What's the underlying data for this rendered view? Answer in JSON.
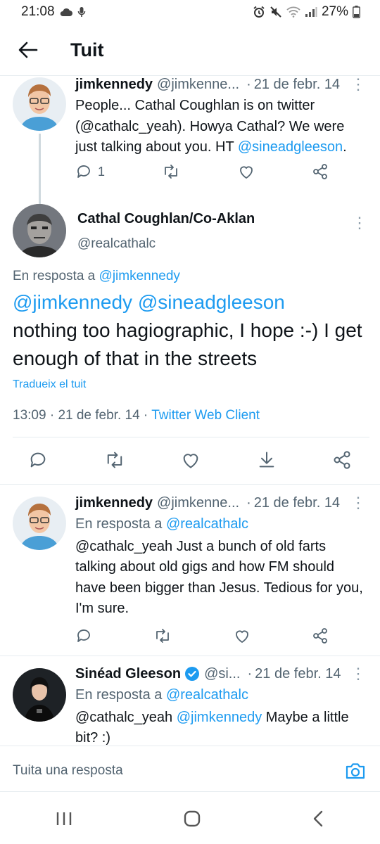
{
  "status_bar": {
    "time": "21:08",
    "battery": "27%"
  },
  "header": {
    "title": "Tuit"
  },
  "tweet1": {
    "name": "jimkennedy",
    "handle": "@jimkenne...",
    "date": "21 de febr. 14",
    "text_main": "People... Cathal Coughlan is on twitter (@cathalc_yeah). Howya Cathal? We were just talking about you. HT ",
    "text_link": "@sineadgleeson",
    "text_end": ".",
    "reply_count": "1"
  },
  "main_tweet": {
    "name": "Cathal Coughlan/Co-Aklan",
    "handle": "@realcathalc",
    "reply_prefix": "En resposta a ",
    "reply_to": "@jimkennedy",
    "mention1": "@jimkennedy",
    "mention2": "@sineadgleeson",
    "body": "nothing too hagiographic, I hope :-) I get enough of that in the streets",
    "translate": "Tradueix el tuit",
    "time": "13:09",
    "date": "21 de febr. 14",
    "client": "Twitter Web Client"
  },
  "tweet3": {
    "name": "jimkennedy",
    "handle": "@jimkenne...",
    "date": "21 de febr. 14",
    "reply_prefix": "En resposta a ",
    "reply_to": "@realcathalc",
    "text": "@cathalc_yeah Just a bunch of old farts talking about old gigs and how FM should have been bigger than Jesus. Tedious for you, I'm sure."
  },
  "tweet4": {
    "name": "Sinéad Gleeson",
    "handle": "@si...",
    "date": "21 de febr. 14",
    "reply_prefix": "En resposta a ",
    "reply_to": "@realcathalc",
    "text_start": "@cathalc_yeah ",
    "text_link": "@jimkennedy",
    "text_end": " Maybe a little bit? :)"
  },
  "reply_bar": {
    "placeholder": "Tuita una resposta"
  },
  "colors": {
    "accent": "#1d9bf0",
    "text": "#0f1419",
    "muted": "#536471",
    "divider": "#e6ecf0"
  }
}
